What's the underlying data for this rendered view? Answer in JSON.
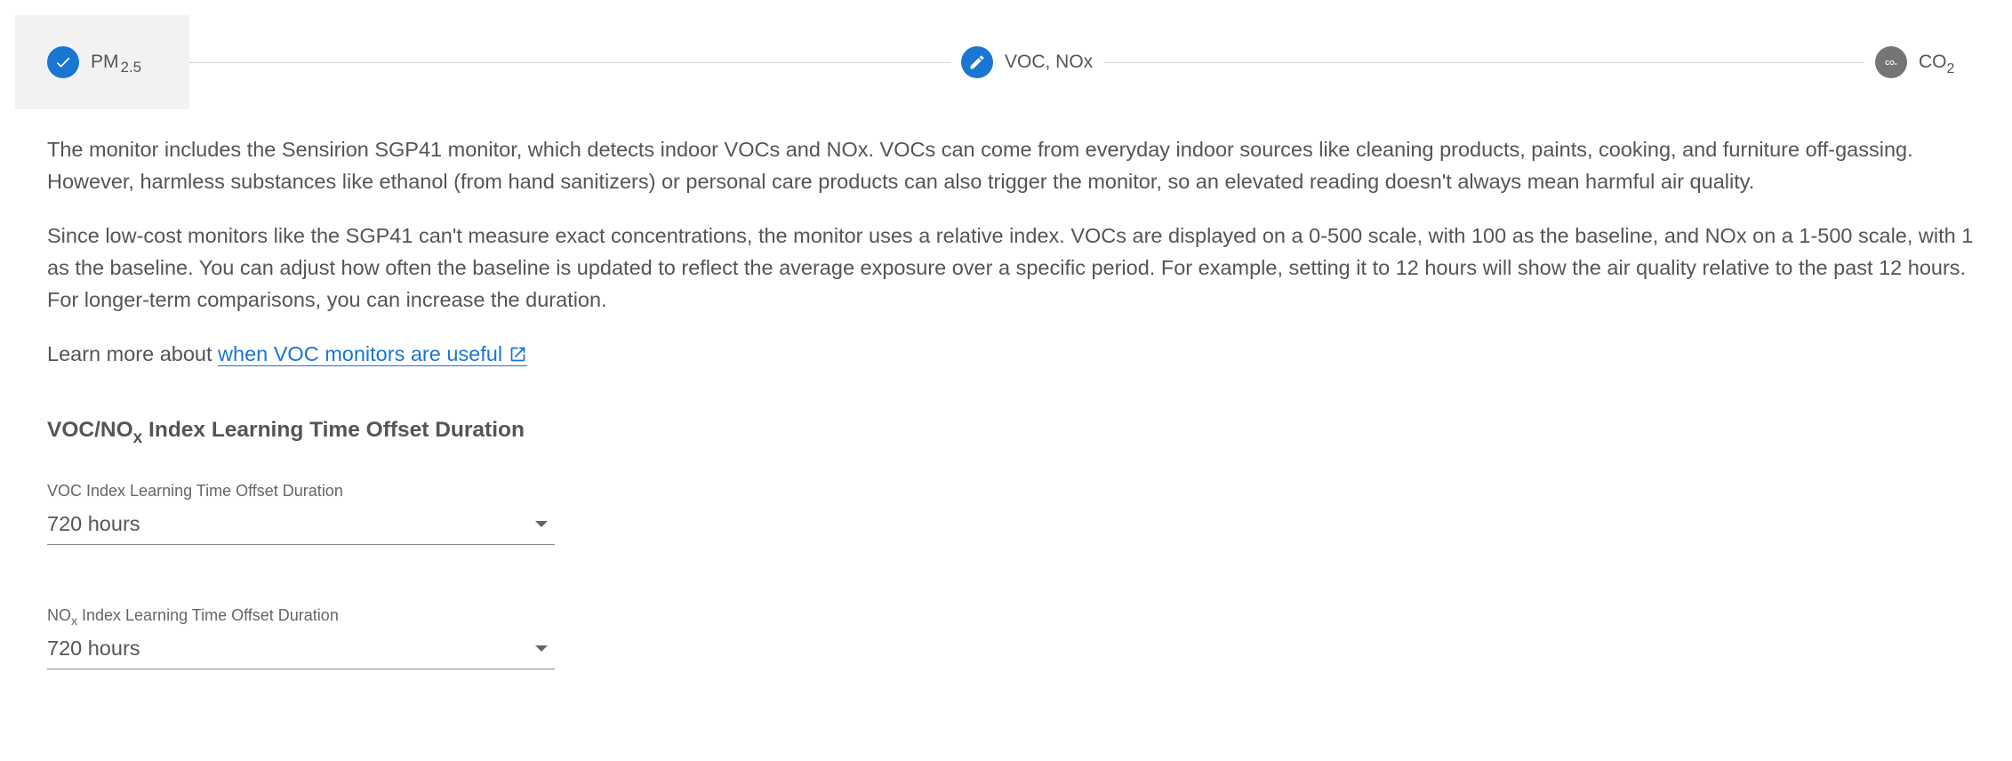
{
  "stepper": {
    "steps": [
      {
        "label": "PM",
        "sub": "2.5",
        "state": "completed",
        "icon": "check-icon"
      },
      {
        "label": "VOC, NOx",
        "state": "active",
        "icon": "pencil-icon"
      },
      {
        "label": "CO",
        "sub": "2",
        "state": "pending",
        "icon": "co2-icon"
      }
    ],
    "co2_icon_text": "CO₂"
  },
  "content": {
    "para1": "The monitor includes the Sensirion SGP41 monitor, which detects indoor VOCs and NOx. VOCs can come from everyday indoor sources like cleaning products, paints, cooking, and furniture off-gassing. However, harmless substances like ethanol (from hand sanitizers) or personal care products can also trigger the monitor, so an elevated reading doesn't always mean harmful air quality.",
    "para2": "Since low-cost monitors like the SGP41 can't measure exact concentrations, the monitor uses a relative index. VOCs are displayed on a 0-500 scale, with 100 as the baseline, and NOx on a 1-500 scale, with 1 as the baseline. You can adjust how often the baseline is updated to reflect the average exposure over a specific period. For example, setting it to 12 hours will show the air quality relative to the past 12 hours. For longer-term comparisons, you can increase the duration.",
    "learn_prefix": "Learn more about ",
    "learn_link": "when VOC monitors are useful"
  },
  "section": {
    "title_a": "VOC/NO",
    "title_sub": "x",
    "title_b": " Index Learning Time Offset Duration"
  },
  "fields": {
    "voc": {
      "label": "VOC Index Learning Time Offset Duration",
      "value": "720 hours"
    },
    "nox": {
      "label_a": "NO",
      "label_sub": "x",
      "label_b": " Index Learning Time Offset Duration",
      "value": "720 hours"
    }
  },
  "colors": {
    "accent": "#1976d2",
    "pending": "#757575",
    "text": "#555555",
    "active_step_bg": "#f2f2f2"
  }
}
